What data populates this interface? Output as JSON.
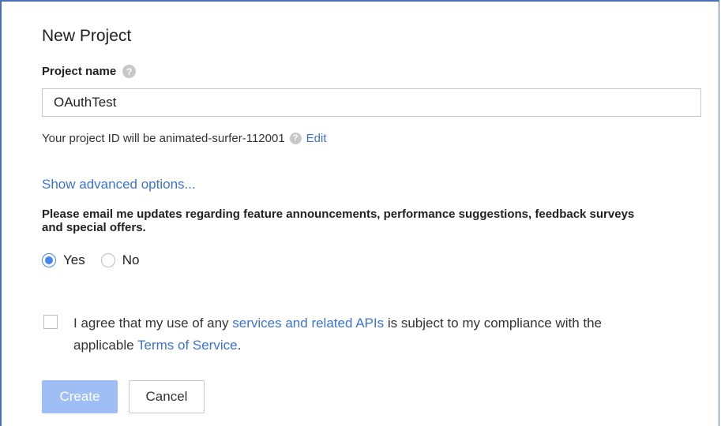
{
  "dialog": {
    "title": "New Project",
    "project_name_label": "Project name",
    "project_name_value": "OAuthTest",
    "project_id_text": "Your project ID will be animated-surfer-112001",
    "edit_link": "Edit",
    "advanced_link": "Show advanced options...",
    "email_pref_text": "Please email me updates regarding feature announcements, performance suggestions, feedback surveys and special offers.",
    "radio_yes": "Yes",
    "radio_no": "No",
    "radio_selected": "Yes",
    "terms_prefix": "I agree that my use of any ",
    "terms_link1": "services and related APIs",
    "terms_middle": " is subject to my compliance with the applicable ",
    "terms_link2": "Terms of Service",
    "terms_suffix": ".",
    "terms_checked": false,
    "create_button": "Create",
    "cancel_button": "Cancel",
    "help_glyph": "?"
  },
  "colors": {
    "accent": "#4285f4",
    "link": "#3b73d2",
    "create_disabled": "#9fbef6",
    "frame": "#4a6fb5"
  },
  "icons": [
    "help-icon"
  ]
}
